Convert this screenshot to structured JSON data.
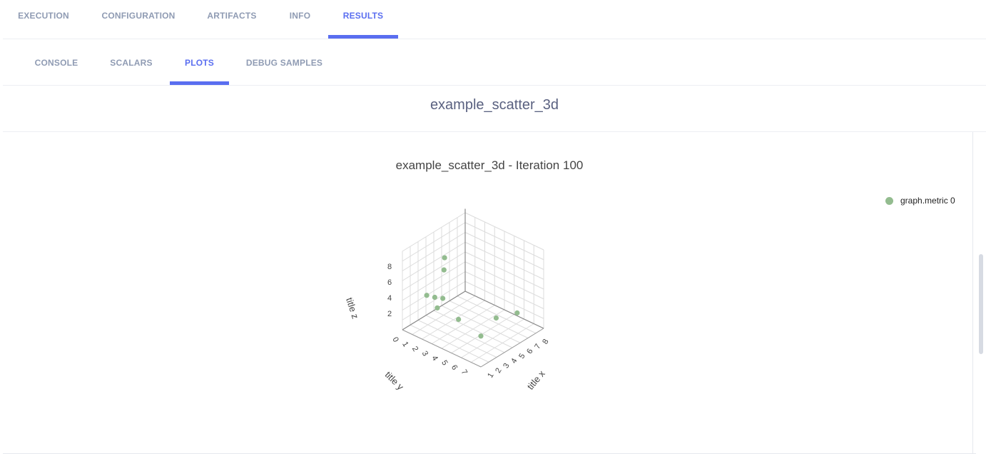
{
  "tabs": {
    "main": [
      {
        "label": "EXECUTION",
        "active": false
      },
      {
        "label": "CONFIGURATION",
        "active": false
      },
      {
        "label": "ARTIFACTS",
        "active": false
      },
      {
        "label": "INFO",
        "active": false
      },
      {
        "label": "RESULTS",
        "active": true
      }
    ],
    "sub": [
      {
        "label": "CONSOLE",
        "active": false
      },
      {
        "label": "SCALARS",
        "active": false
      },
      {
        "label": "PLOTS",
        "active": true
      },
      {
        "label": "DEBUG SAMPLES",
        "active": false
      }
    ]
  },
  "plot": {
    "header": "example_scatter_3d",
    "title": "example_scatter_3d - Iteration 100",
    "legend": {
      "label": "graph.metric 0",
      "color": "#93bc8f"
    }
  },
  "chart_data": {
    "type": "scatter",
    "title": "example_scatter_3d - Iteration 100",
    "xlabel": "title x",
    "ylabel": "title y",
    "zlabel": "title z",
    "xticks": [
      "1",
      "2",
      "3",
      "4",
      "5",
      "6",
      "7",
      "8"
    ],
    "yticks": [
      "0",
      "1",
      "2",
      "3",
      "4",
      "5",
      "6",
      "7"
    ],
    "zticks": [
      "2",
      "4",
      "6",
      "8"
    ],
    "series": [
      {
        "name": "graph.metric 0",
        "color": "#93bc8f",
        "x": [
          1.5,
          5.5,
          4.2,
          2.8,
          6.5,
          7.6,
          7.0,
          7.4,
          5.8,
          5.6
        ],
        "y": [
          6.5,
          2.3,
          1.2,
          5.4,
          6.8,
          3.8,
          2.5,
          2.0,
          1.8,
          3.8
        ],
        "z": [
          2.0,
          9.0,
          6.0,
          1.5,
          2.3,
          6.0,
          5.0,
          5.2,
          2.5,
          2.1
        ]
      }
    ]
  }
}
